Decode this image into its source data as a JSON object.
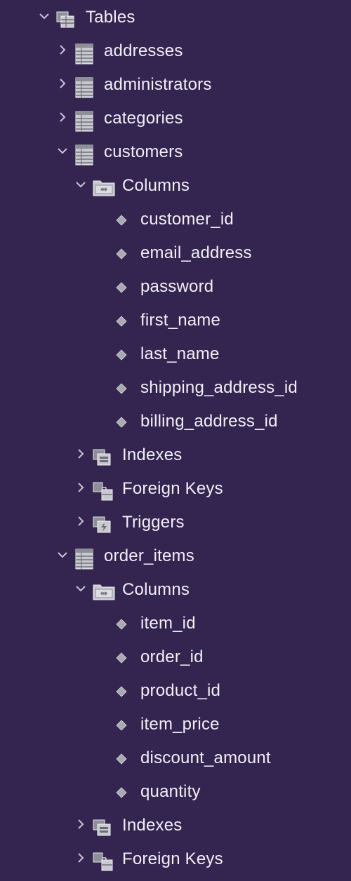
{
  "tree": {
    "root_label": "Tables",
    "tables": [
      {
        "label": "addresses",
        "expanded": false
      },
      {
        "label": "administrators",
        "expanded": false
      },
      {
        "label": "categories",
        "expanded": false
      },
      {
        "label": "customers",
        "expanded": true,
        "columns_label": "Columns",
        "columns": [
          "customer_id",
          "email_address",
          "password",
          "first_name",
          "last_name",
          "shipping_address_id",
          "billing_address_id"
        ],
        "indexes_label": "Indexes",
        "foreign_keys_label": "Foreign Keys",
        "triggers_label": "Triggers"
      },
      {
        "label": "order_items",
        "expanded": true,
        "columns_label": "Columns",
        "columns": [
          "item_id",
          "order_id",
          "product_id",
          "item_price",
          "discount_amount",
          "quantity"
        ],
        "indexes_label": "Indexes",
        "foreign_keys_label": "Foreign Keys"
      }
    ]
  },
  "colors": {
    "background": "#33254f",
    "text": "#f2eff8",
    "chevron": "#c9c3d8",
    "icon_fill": "#bdbdc4"
  },
  "icons": {
    "group": "tables-group-icon",
    "table": "table-icon",
    "folder": "columns-folder-icon",
    "column": "column-diamond-icon",
    "indexes": "indexes-icon",
    "foreign_keys": "foreign-keys-icon",
    "triggers": "triggers-icon"
  }
}
